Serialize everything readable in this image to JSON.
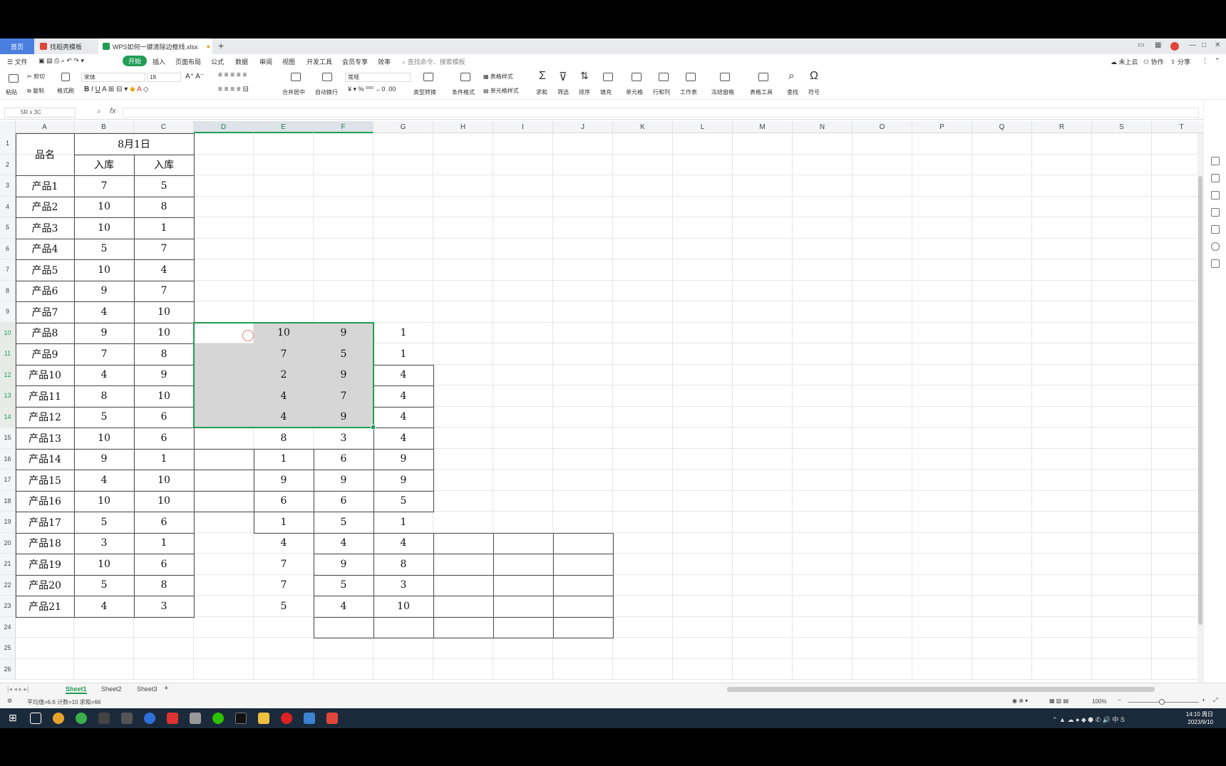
{
  "tabs": {
    "home": "首页",
    "template": "找稻壳模板",
    "file": "WPS如何一键清除边框线.xlsx"
  },
  "menu": {
    "file": "文件",
    "items": [
      "开始",
      "插入",
      "页面布局",
      "公式",
      "数据",
      "审阅",
      "视图",
      "开发工具",
      "会员专享",
      "效率"
    ],
    "search": "查找命令、搜索模板",
    "right": [
      "未上云",
      "协作",
      "分享"
    ]
  },
  "ribbon": {
    "paste": "粘贴",
    "cut": "剪切",
    "copy": "复制",
    "format_painter": "格式刷",
    "font": "宋体",
    "font_size": "18",
    "number_format": "常规",
    "merge": "合并居中",
    "wrap": "自动换行",
    "type_convert": "类型转换",
    "cond_format": "条件格式",
    "table_style": "表格样式",
    "cell_style": "单元格样式",
    "sum": "求和",
    "filter": "筛选",
    "sort": "排序",
    "fill": "填充",
    "cell": "单元格",
    "rowcol": "行和列",
    "worksheet": "工作表",
    "freeze": "冻结窗格",
    "tools": "表格工具",
    "find": "查找",
    "symbol": "符号"
  },
  "formula": {
    "name_box": "5R x 3C",
    "fx": "fx",
    "value": ""
  },
  "columns": [
    "A",
    "B",
    "C",
    "D",
    "E",
    "F",
    "G",
    "H",
    "I",
    "J",
    "K",
    "L",
    "M",
    "N",
    "O",
    "P",
    "Q",
    "R",
    "S",
    "T"
  ],
  "rows": [
    "1",
    "2",
    "3",
    "4",
    "5",
    "6",
    "7",
    "8",
    "9",
    "10",
    "11",
    "12",
    "13",
    "14",
    "15",
    "16",
    "17",
    "18",
    "19",
    "20",
    "21",
    "22",
    "23",
    "24",
    "25",
    "26"
  ],
  "table": {
    "header_name": "品名",
    "header_date": "8月1日",
    "header_in1": "入库",
    "header_in2": "入库",
    "products": [
      "产品1",
      "产品2",
      "产品3",
      "产品4",
      "产品5",
      "产品6",
      "产品7",
      "产品8",
      "产品9",
      "产品10",
      "产品11",
      "产品12",
      "产品13",
      "产品14",
      "产品15",
      "产品16",
      "产品17",
      "产品18",
      "产品19",
      "产品20",
      "产品21"
    ],
    "col_b": [
      "7",
      "10",
      "10",
      "5",
      "10",
      "9",
      "4",
      "9",
      "7",
      "4",
      "8",
      "5",
      "10",
      "9",
      "4",
      "10",
      "5",
      "3",
      "10",
      "5",
      "4"
    ],
    "col_c": [
      "5",
      "8",
      "1",
      "7",
      "4",
      "7",
      "10",
      "10",
      "8",
      "9",
      "10",
      "6",
      "6",
      "1",
      "10",
      "10",
      "6",
      "1",
      "6",
      "8",
      "3"
    ],
    "col_e": [
      "10",
      "7",
      "2",
      "4",
      "4",
      "8",
      "1",
      "9",
      "6",
      "1",
      "4",
      "7",
      "7",
      "5"
    ],
    "col_f": [
      "9",
      "5",
      "9",
      "7",
      "9",
      "3",
      "6",
      "9",
      "6",
      "5",
      "4",
      "9",
      "5",
      "4"
    ],
    "col_g": [
      "1",
      "1",
      "4",
      "4",
      "4",
      "4",
      "9",
      "9",
      "5",
      "1",
      "4",
      "8",
      "3",
      "10"
    ]
  },
  "sheets": [
    "Sheet1",
    "Sheet2",
    "Sheet3"
  ],
  "status": {
    "stats": "平均值=6.6  计数=10  求和=66",
    "zoom": "100%"
  },
  "clock": {
    "time": "14:10 周日",
    "date": "2023/9/10"
  },
  "colors": {
    "accent": "#1f9d55",
    "home_tab": "#4a7fe0",
    "selection_fill": "#d6d6d6"
  }
}
